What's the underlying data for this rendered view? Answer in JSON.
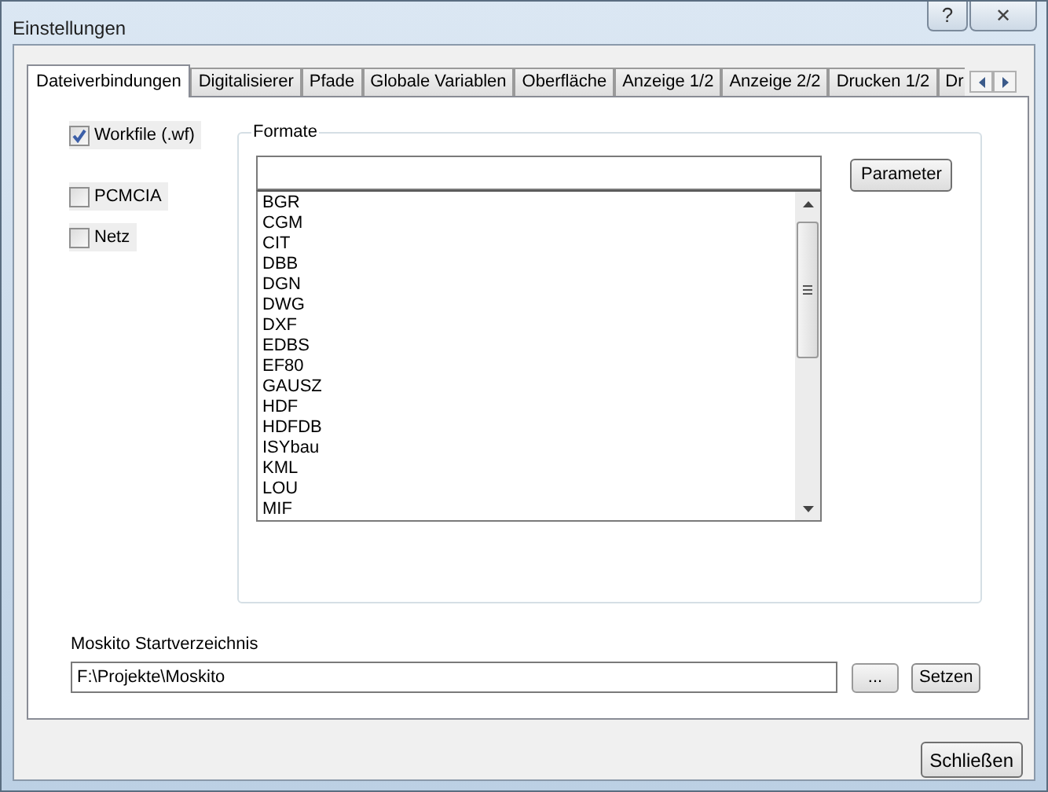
{
  "window": {
    "title": "Einstellungen",
    "buttons": [
      {
        "kind": "help",
        "label": "?"
      },
      {
        "kind": "close",
        "label": "✕"
      }
    ]
  },
  "tabs": [
    {
      "label": "Dateiverbindungen",
      "selected": true
    },
    {
      "label": "Digitalisierer",
      "selected": false
    },
    {
      "label": "Pfade",
      "selected": false
    },
    {
      "label": "Globale Variablen",
      "selected": false
    },
    {
      "label": "Oberfläche",
      "selected": false
    },
    {
      "label": "Anzeige 1/2",
      "selected": false
    },
    {
      "label": "Anzeige 2/2",
      "selected": false
    },
    {
      "label": "Drucken 1/2",
      "selected": false
    },
    {
      "label": "Dr",
      "selected": false
    }
  ],
  "checkboxes": [
    {
      "label": "Workfile (.wf)",
      "checked": true
    },
    {
      "label": "PCMCIA",
      "checked": false
    },
    {
      "label": "Netz",
      "checked": false
    }
  ],
  "formate": {
    "title": "Formate",
    "parameter_button": "Parameter",
    "items": [
      "BGR",
      "CGM",
      "CIT",
      "DBB",
      "DGN",
      "DWG",
      "DXF",
      "EDBS",
      "EF80",
      "GAUSZ",
      "HDF",
      "HDFDB",
      "ISYbau",
      "KML",
      "LOU",
      "MIF"
    ]
  },
  "start_dir": {
    "label": "Moskito Startverzeichnis",
    "value": "F:\\Projekte\\Moskito",
    "browse_button": "...",
    "set_button": "Setzen"
  },
  "close_button": "Schließen"
}
